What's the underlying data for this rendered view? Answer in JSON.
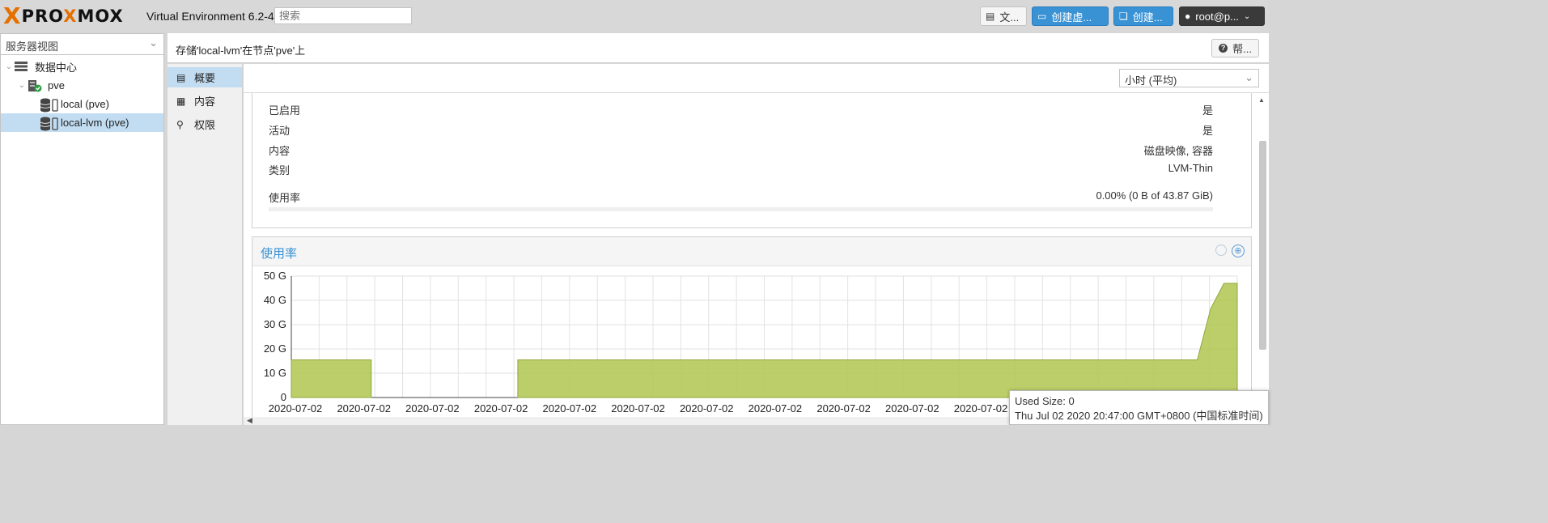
{
  "topbar": {
    "logo_text": "PROXMOX",
    "version": "Virtual Environment 6.2-4",
    "search_placeholder": "搜索",
    "docs_label": "文...",
    "create_vm_label": "创建虚...",
    "create_ct_label": "创建...",
    "user_label": "root@p..."
  },
  "sidebar": {
    "view_label": "服务器视图",
    "tree": {
      "datacenter": "数据中心",
      "node": "pve",
      "storage_local": "local (pve)",
      "storage_lvm": "local-lvm (pve)"
    }
  },
  "header": {
    "title": "存储'local-lvm'在节点'pve'上",
    "help_label": "帮..."
  },
  "subnav": {
    "items": [
      {
        "label": "概要",
        "icon": "book-icon",
        "selected": true
      },
      {
        "label": "内容",
        "icon": "grid-icon",
        "selected": false
      },
      {
        "label": "权限",
        "icon": "unlock-icon",
        "selected": false
      }
    ]
  },
  "content": {
    "timeframe": "小时 (平均)",
    "status": {
      "enabled_label": "已启用",
      "enabled_value": "是",
      "active_label": "活动",
      "active_value": "是",
      "content_label": "内容",
      "content_value": "磁盘映像, 容器",
      "type_label": "类别",
      "type_value": "LVM-Thin",
      "usage_label": "使用率",
      "usage_value": "0.00% (0 B of 43.87 GiB)",
      "usage_fraction": 0.0
    },
    "chart_title": "使用率"
  },
  "tooltip": {
    "line1": "Used Size: 0",
    "line2": "Thu Jul 02 2020 20:47:00 GMT+0800 (中国标准时间)"
  },
  "colors": {
    "accent": "#3892d4",
    "logo_orange": "#e57000",
    "area_fill": "#b5c95a",
    "area_stroke": "#8fa83a",
    "selection": "#c2ddf2"
  },
  "chart_data": {
    "type": "area",
    "title": "使用率",
    "ylabel": "",
    "xlabel": "",
    "ylim": [
      0,
      50
    ],
    "y_ticks": [
      "0",
      "10 G",
      "20 G",
      "30 G",
      "40 G",
      "50 G"
    ],
    "x_tick_labels": [
      "2020-07-02",
      "2020-07-02",
      "2020-07-02",
      "2020-07-02",
      "2020-07-02",
      "2020-07-02",
      "2020-07-02",
      "2020-07-02",
      "2020-07-02",
      "2020-07-02",
      "2020-07-02",
      "2020-07-02",
      "2020-07-02"
    ],
    "grid": true,
    "series": [
      {
        "values": [
          15.5,
          15.5,
          15.5,
          15.5,
          15.5,
          15.5,
          15.5,
          null,
          null,
          null,
          null,
          null,
          null,
          null,
          null,
          null,
          null,
          15.5,
          15.5,
          15.5,
          15.5,
          15.5,
          15.5,
          15.5,
          15.5,
          15.5,
          15.5,
          15.5,
          15.5,
          15.5,
          15.5,
          15.5,
          15.5,
          15.5,
          15.5,
          15.5,
          15.5,
          15.5,
          15.5,
          15.5,
          15.5,
          15.5,
          15.5,
          15.5,
          15.5,
          15.5,
          15.5,
          15.5,
          15.5,
          15.5,
          15.5,
          15.5,
          15.5,
          15.5,
          15.5,
          15.5,
          15.5,
          15.5,
          15.5,
          15.5,
          15.5,
          15.5,
          15.5,
          15.5,
          15.5,
          15.5,
          15.5,
          15.5,
          15.5,
          36.5,
          47,
          47
        ]
      }
    ]
  }
}
